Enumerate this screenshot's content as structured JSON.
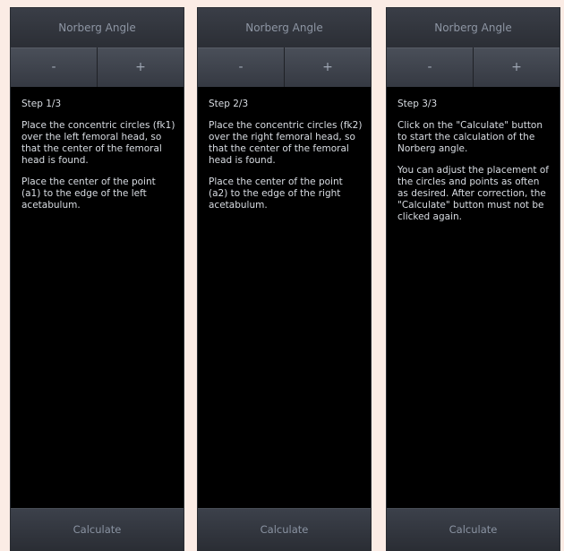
{
  "panels": [
    {
      "title": "Norberg Angle",
      "minus": "-",
      "plus": "+",
      "step": "Step 1/3",
      "paragraphs": [
        "Place the concentric circles (fk1) over the left femoral head, so that the center of the femoral head is found.",
        "Place the center of the point (a1) to the edge of the left acetabulum."
      ],
      "calculate": "Calculate"
    },
    {
      "title": "Norberg Angle",
      "minus": "-",
      "plus": "+",
      "step": "Step 2/3",
      "paragraphs": [
        "Place the concentric circles (fk2) over the right femoral head, so that the center of the femoral head is found.",
        "Place the center of the point (a2) to the edge of the right acetabulum."
      ],
      "calculate": "Calculate"
    },
    {
      "title": "Norberg Angle",
      "minus": "-",
      "plus": "+",
      "step": "Step 3/3",
      "paragraphs": [
        "Click on the \"Calculate\" button to start the calculation of the Norberg angle.",
        "You can adjust the placement of the circles and points as often as desired. After correction, the \"Calculate\" button must not be clicked again."
      ],
      "calculate": "Calculate"
    }
  ]
}
